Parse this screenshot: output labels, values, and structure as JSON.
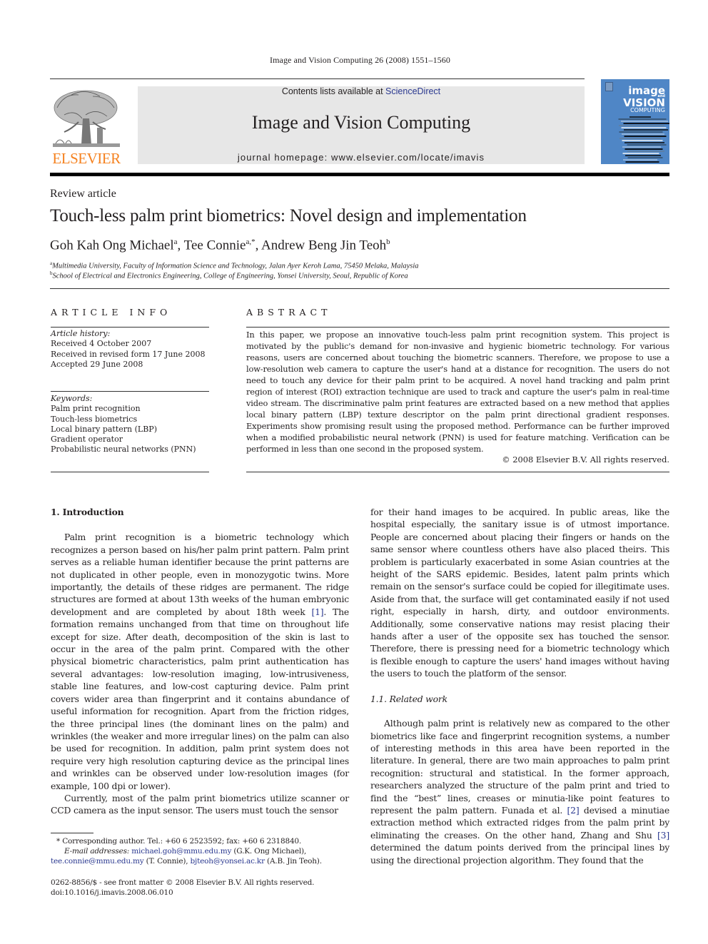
{
  "running_head": "Image and Vision Computing 26 (2008) 1551–1560",
  "masthead": {
    "publisher_logo_text": "ELSEVIER",
    "contents_prefix": "Contents lists available at ",
    "contents_link": "ScienceDirect",
    "journal_name": "Image and Vision Computing",
    "homepage": "journal homepage: www.elsevier.com/locate/imavis",
    "cover_title_lines": [
      "image",
      "and",
      "VISION",
      "COMPUTING"
    ],
    "colors": {
      "elsevier_orange": "#f58220",
      "banner_gray": "#e7e7e7",
      "cover_blue": "#4f86c6",
      "link_blue": "#2b3990"
    }
  },
  "article": {
    "type": "Review article",
    "title": "Touch-less palm print biometrics: Novel design and implementation",
    "authors": [
      {
        "name": "Goh Kah Ong Michael",
        "sup": "a",
        "sep": ", "
      },
      {
        "name": "Tee Connie",
        "sup": "a,*",
        "sep": ", "
      },
      {
        "name": "Andrew Beng Jin Teoh",
        "sup": "b",
        "sep": ""
      }
    ],
    "affiliations": [
      {
        "mark": "a",
        "text": "Multimedia University, Faculty of Information Science and Technology, Jalan Ayer Keroh Lama, 75450 Melaka, Malaysia"
      },
      {
        "mark": "b",
        "text": "School of Electrical and Electronics Engineering, College of Engineering, Yonsei University, Seoul, Republic of Korea"
      }
    ]
  },
  "article_info": {
    "heading": "ARTICLE INFO",
    "history_label": "Article history:",
    "history": [
      "Received 4 October 2007",
      "Received in revised form 17 June 2008",
      "Accepted 29 June 2008"
    ],
    "keywords_label": "Keywords:",
    "keywords": [
      "Palm print recognition",
      "Touch-less biometrics",
      "Local binary pattern (LBP)",
      "Gradient operator",
      "Probabilistic neural networks (PNN)"
    ]
  },
  "abstract": {
    "heading": "ABSTRACT",
    "text": "In this paper, we propose an innovative touch-less palm print recognition system. This project is motivated by the public's demand for non-invasive and hygienic biometric technology. For various reasons, users are concerned about touching the biometric scanners. Therefore, we propose to use a low-resolution web camera to capture the user's hand at a distance for recognition. The users do not need to touch any device for their palm print to be acquired. A novel hand tracking and palm print region of interest (ROI) extraction technique are used to track and capture the user's palm in real-time video stream. The discriminative palm print features are extracted based on a new method that applies local binary pattern (LBP) texture descriptor on the palm print directional gradient responses. Experiments show promising result using the proposed method. Performance can be further improved when a modified probabilistic neural network (PNN) is used for feature matching. Verification can be performed in less than one second in the proposed system.",
    "copyright": "© 2008 Elsevier B.V. All rights reserved."
  },
  "body": {
    "section1_heading": "1. Introduction",
    "p1_before_ref": "Palm print recognition is a biometric technology which recognizes a person based on his/her palm print pattern. Palm print serves as a reliable human identifier because the print patterns are not duplicated in other people, even in monozygotic twins. More importantly, the details of these ridges are permanent. The ridge structures are formed at about 13th weeks of the human embryonic development and are completed by about 18th week ",
    "p1_ref": "[1]",
    "p1_after_ref": ". The formation remains unchanged from that time on throughout life except for size. After death, decomposition of the skin is last to occur in the area of the palm print. Compared with the other physical biometric characteristics, palm print authentication has several advantages: low-resolution imaging, low-intrusiveness, stable line features, and low-cost capturing device. Palm print covers wider area than fingerprint and it contains abundance of useful information for recognition. Apart from the friction ridges, the three principal lines (the dominant lines on the palm) and wrinkles (the weaker and more irregular lines) on the palm can also be used for recognition. In addition, palm print system does not require very high resolution capturing device as the principal lines and wrinkles can be observed under low-resolution images (for example, 100 dpi or lower).",
    "p2_left": "Currently, most of the palm print biometrics utilize scanner or CCD camera as the input sensor. The users must touch the sensor",
    "p2_right": "for their hand images to be acquired. In public areas, like the hospital especially, the sanitary issue is of utmost importance. People are concerned about placing their fingers or hands on the same sensor where countless others have also placed theirs. This problem is particularly exacerbated in some Asian countries at the height of the SARS epidemic. Besides, latent palm prints which remain on the sensor's surface could be copied for illegitimate uses. Aside from that, the surface will get contaminated easily if not used right, especially in harsh, dirty, and outdoor environments. Additionally, some conservative nations may resist placing their hands after a user of the opposite sex has touched the sensor. Therefore, there is pressing need for a biometric technology which is flexible enough to capture the users' hand images without having the users to touch the platform of the sensor.",
    "subsection_heading": "1.1. Related work",
    "p3_a": "Although palm print is relatively new as compared to the other biometrics like face and fingerprint recognition systems, a number of interesting methods in this area have been reported in the literature. In general, there are two main approaches to palm print recognition: structural and statistical. In the former approach, researchers analyzed the structure of the palm print and tried to find the “best” lines, creases or minutia-like point features to represent the palm pattern. Funada et al. ",
    "p3_ref2": "[2]",
    "p3_b": " devised a minutiae extraction method which extracted ridges from the palm print by eliminating the creases. On the other hand, Zhang and Shu ",
    "p3_ref3": "[3]",
    "p3_c": " determined the datum points derived from the principal lines by using the directional projection algorithm. They found that the"
  },
  "footnotes": {
    "corresponding": "* Corresponding author. Tel.: +60 6 2523592; fax: +60 6 2318840.",
    "email_label": "E-mail addresses:",
    "email1": "michael.goh@mmu.edu.my",
    "email1_who": " (G.K. Ong Michael), ",
    "email2": "tee.connie@mmu.edu.my",
    "email2_who": " (T. Connie), ",
    "email3": "bjteoh@yonsei.ac.kr",
    "email3_who": " (A.B. Jin Teoh).",
    "issn_line": "0262-8856/$ - see front matter © 2008 Elsevier B.V. All rights reserved.",
    "doi": "doi:10.1016/j.imavis.2008.06.010"
  }
}
